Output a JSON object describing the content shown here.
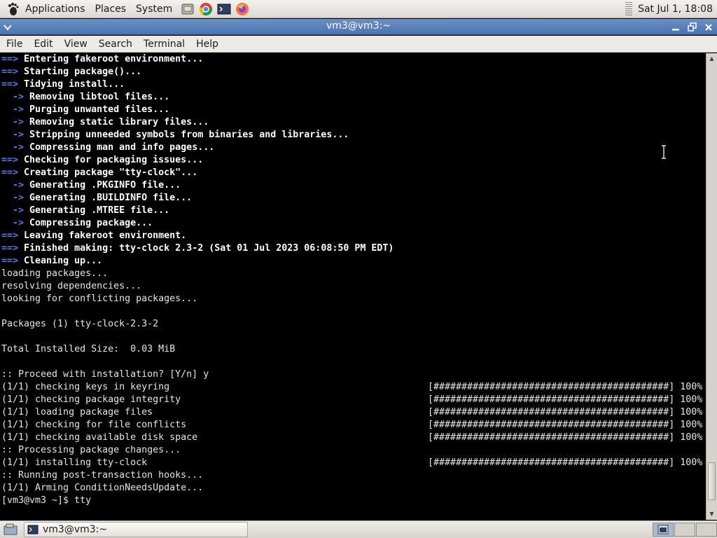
{
  "top_panel": {
    "menus": [
      "Applications",
      "Places",
      "System"
    ],
    "launchers": [
      "file-manager-icon",
      "chrome-icon",
      "terminal-icon",
      "firefox-icon"
    ],
    "clock": "Sat Jul 1, 18:08"
  },
  "window": {
    "title": "vm3@vm3:~"
  },
  "menu_bar": [
    "File",
    "Edit",
    "View",
    "Search",
    "Terminal",
    "Help"
  ],
  "terminal": {
    "lines": [
      {
        "prefix": "==> ",
        "text": "Entering fakeroot environment...",
        "style": "top"
      },
      {
        "prefix": "==> ",
        "text": "Starting package()...",
        "style": "top"
      },
      {
        "prefix": "==> ",
        "text": "Tidying install...",
        "style": "top"
      },
      {
        "prefix": "  -> ",
        "text": "Removing libtool files...",
        "style": "sub"
      },
      {
        "prefix": "  -> ",
        "text": "Purging unwanted files...",
        "style": "sub"
      },
      {
        "prefix": "  -> ",
        "text": "Removing static library files...",
        "style": "sub"
      },
      {
        "prefix": "  -> ",
        "text": "Stripping unneeded symbols from binaries and libraries...",
        "style": "sub"
      },
      {
        "prefix": "  -> ",
        "text": "Compressing man and info pages...",
        "style": "sub"
      },
      {
        "prefix": "==> ",
        "text": "Checking for packaging issues...",
        "style": "top"
      },
      {
        "prefix": "==> ",
        "text": "Creating package \"tty-clock\"...",
        "style": "top"
      },
      {
        "prefix": "  -> ",
        "text": "Generating .PKGINFO file...",
        "style": "sub"
      },
      {
        "prefix": "  -> ",
        "text": "Generating .BUILDINFO file...",
        "style": "sub"
      },
      {
        "prefix": "  -> ",
        "text": "Generating .MTREE file...",
        "style": "sub"
      },
      {
        "prefix": "  -> ",
        "text": "Compressing package...",
        "style": "sub"
      },
      {
        "prefix": "==> ",
        "text": "Leaving fakeroot environment.",
        "style": "top"
      },
      {
        "prefix": "==> ",
        "text": "Finished making: tty-clock 2.3-2 (Sat 01 Jul 2023 06:08:50 PM EDT)",
        "style": "top"
      },
      {
        "prefix": "==> ",
        "text": "Cleaning up...",
        "style": "top"
      },
      {
        "prefix": "",
        "text": "loading packages...",
        "style": "plain"
      },
      {
        "prefix": "",
        "text": "resolving dependencies...",
        "style": "plain"
      },
      {
        "prefix": "",
        "text": "looking for conflicting packages...",
        "style": "plain"
      },
      {
        "prefix": "",
        "text": "",
        "style": "plain"
      },
      {
        "prefix": "",
        "text": "Packages (1) tty-clock-2.3-2",
        "style": "plain"
      },
      {
        "prefix": "",
        "text": "",
        "style": "plain"
      },
      {
        "prefix": "",
        "text": "Total Installed Size:  0.03 MiB",
        "style": "plain"
      },
      {
        "prefix": "",
        "text": "",
        "style": "plain"
      },
      {
        "prefix": "",
        "text": ":: Proceed with installation? [Y/n] y",
        "style": "plain"
      },
      {
        "prefix": "",
        "text": "(1/1) checking keys in keyring",
        "style": "plain",
        "progress": "[##########################################] 100%"
      },
      {
        "prefix": "",
        "text": "(1/1) checking package integrity",
        "style": "plain",
        "progress": "[##########################################] 100%"
      },
      {
        "prefix": "",
        "text": "(1/1) loading package files",
        "style": "plain",
        "progress": "[##########################################] 100%"
      },
      {
        "prefix": "",
        "text": "(1/1) checking for file conflicts",
        "style": "plain",
        "progress": "[##########################################] 100%"
      },
      {
        "prefix": "",
        "text": "(1/1) checking available disk space",
        "style": "plain",
        "progress": "[##########################################] 100%"
      },
      {
        "prefix": "",
        "text": ":: Processing package changes...",
        "style": "plain"
      },
      {
        "prefix": "",
        "text": "(1/1) installing tty-clock",
        "style": "plain",
        "progress": "[##########################################] 100%"
      },
      {
        "prefix": "",
        "text": ":: Running post-transaction hooks...",
        "style": "plain"
      },
      {
        "prefix": "",
        "text": "(1/1) Arming ConditionNeedsUpdate...",
        "style": "plain"
      },
      {
        "prefix": "",
        "text": "[vm3@vm3 ~]$ tty",
        "style": "plain"
      }
    ]
  },
  "bottom_panel": {
    "task_label": "vm3@vm3:~"
  },
  "colors": {
    "arrow": "#4f7de8",
    "title_bar": "#4a74b2"
  }
}
